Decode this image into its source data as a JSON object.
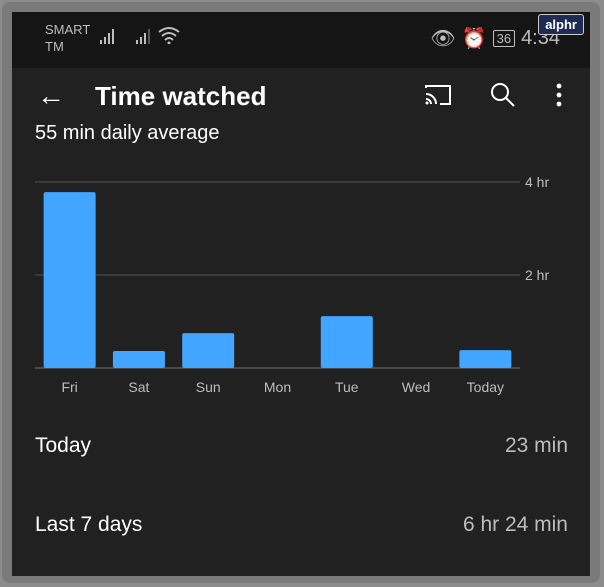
{
  "status_bar": {
    "carrier_line1": "SMART",
    "carrier_line2": "TM",
    "battery": "36",
    "time": "4:34"
  },
  "brand": "alphr",
  "app_bar": {
    "title": "Time watched",
    "icons": [
      "back-arrow-icon",
      "cast-icon",
      "search-icon",
      "more-vert-icon"
    ]
  },
  "daily_average": "55 min daily average",
  "chart_data": {
    "type": "bar",
    "categories": [
      "Fri",
      "Sat",
      "Sun",
      "Mon",
      "Tue",
      "Wed",
      "Today"
    ],
    "values": [
      227,
      22,
      45,
      0,
      67,
      0,
      23
    ],
    "unit": "min",
    "y_ticks": [
      {
        "value": 240,
        "label": "4 hr"
      },
      {
        "value": 120,
        "label": "2 hr"
      }
    ],
    "ylim": [
      0,
      240
    ],
    "grid": true,
    "bar_color": "#42a5ff"
  },
  "summary": [
    {
      "label": "Today",
      "value": "23 min"
    },
    {
      "label": "Last 7 days",
      "value": "6 hr 24 min"
    }
  ]
}
